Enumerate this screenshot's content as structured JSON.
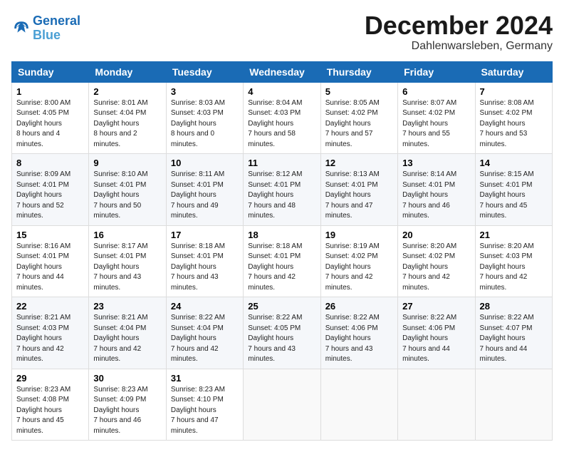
{
  "header": {
    "logo_line1": "General",
    "logo_line2": "Blue",
    "month": "December 2024",
    "location": "Dahlenwarsleben, Germany"
  },
  "weekdays": [
    "Sunday",
    "Monday",
    "Tuesday",
    "Wednesday",
    "Thursday",
    "Friday",
    "Saturday"
  ],
  "weeks": [
    [
      {
        "day": "1",
        "sunrise": "8:00 AM",
        "sunset": "4:05 PM",
        "daylight": "8 hours and 4 minutes."
      },
      {
        "day": "2",
        "sunrise": "8:01 AM",
        "sunset": "4:04 PM",
        "daylight": "8 hours and 2 minutes."
      },
      {
        "day": "3",
        "sunrise": "8:03 AM",
        "sunset": "4:03 PM",
        "daylight": "8 hours and 0 minutes."
      },
      {
        "day": "4",
        "sunrise": "8:04 AM",
        "sunset": "4:03 PM",
        "daylight": "7 hours and 58 minutes."
      },
      {
        "day": "5",
        "sunrise": "8:05 AM",
        "sunset": "4:02 PM",
        "daylight": "7 hours and 57 minutes."
      },
      {
        "day": "6",
        "sunrise": "8:07 AM",
        "sunset": "4:02 PM",
        "daylight": "7 hours and 55 minutes."
      },
      {
        "day": "7",
        "sunrise": "8:08 AM",
        "sunset": "4:02 PM",
        "daylight": "7 hours and 53 minutes."
      }
    ],
    [
      {
        "day": "8",
        "sunrise": "8:09 AM",
        "sunset": "4:01 PM",
        "daylight": "7 hours and 52 minutes."
      },
      {
        "day": "9",
        "sunrise": "8:10 AM",
        "sunset": "4:01 PM",
        "daylight": "7 hours and 50 minutes."
      },
      {
        "day": "10",
        "sunrise": "8:11 AM",
        "sunset": "4:01 PM",
        "daylight": "7 hours and 49 minutes."
      },
      {
        "day": "11",
        "sunrise": "8:12 AM",
        "sunset": "4:01 PM",
        "daylight": "7 hours and 48 minutes."
      },
      {
        "day": "12",
        "sunrise": "8:13 AM",
        "sunset": "4:01 PM",
        "daylight": "7 hours and 47 minutes."
      },
      {
        "day": "13",
        "sunrise": "8:14 AM",
        "sunset": "4:01 PM",
        "daylight": "7 hours and 46 minutes."
      },
      {
        "day": "14",
        "sunrise": "8:15 AM",
        "sunset": "4:01 PM",
        "daylight": "7 hours and 45 minutes."
      }
    ],
    [
      {
        "day": "15",
        "sunrise": "8:16 AM",
        "sunset": "4:01 PM",
        "daylight": "7 hours and 44 minutes."
      },
      {
        "day": "16",
        "sunrise": "8:17 AM",
        "sunset": "4:01 PM",
        "daylight": "7 hours and 43 minutes."
      },
      {
        "day": "17",
        "sunrise": "8:18 AM",
        "sunset": "4:01 PM",
        "daylight": "7 hours and 43 minutes."
      },
      {
        "day": "18",
        "sunrise": "8:18 AM",
        "sunset": "4:01 PM",
        "daylight": "7 hours and 42 minutes."
      },
      {
        "day": "19",
        "sunrise": "8:19 AM",
        "sunset": "4:02 PM",
        "daylight": "7 hours and 42 minutes."
      },
      {
        "day": "20",
        "sunrise": "8:20 AM",
        "sunset": "4:02 PM",
        "daylight": "7 hours and 42 minutes."
      },
      {
        "day": "21",
        "sunrise": "8:20 AM",
        "sunset": "4:03 PM",
        "daylight": "7 hours and 42 minutes."
      }
    ],
    [
      {
        "day": "22",
        "sunrise": "8:21 AM",
        "sunset": "4:03 PM",
        "daylight": "7 hours and 42 minutes."
      },
      {
        "day": "23",
        "sunrise": "8:21 AM",
        "sunset": "4:04 PM",
        "daylight": "7 hours and 42 minutes."
      },
      {
        "day": "24",
        "sunrise": "8:22 AM",
        "sunset": "4:04 PM",
        "daylight": "7 hours and 42 minutes."
      },
      {
        "day": "25",
        "sunrise": "8:22 AM",
        "sunset": "4:05 PM",
        "daylight": "7 hours and 43 minutes."
      },
      {
        "day": "26",
        "sunrise": "8:22 AM",
        "sunset": "4:06 PM",
        "daylight": "7 hours and 43 minutes."
      },
      {
        "day": "27",
        "sunrise": "8:22 AM",
        "sunset": "4:06 PM",
        "daylight": "7 hours and 44 minutes."
      },
      {
        "day": "28",
        "sunrise": "8:22 AM",
        "sunset": "4:07 PM",
        "daylight": "7 hours and 44 minutes."
      }
    ],
    [
      {
        "day": "29",
        "sunrise": "8:23 AM",
        "sunset": "4:08 PM",
        "daylight": "7 hours and 45 minutes."
      },
      {
        "day": "30",
        "sunrise": "8:23 AM",
        "sunset": "4:09 PM",
        "daylight": "7 hours and 46 minutes."
      },
      {
        "day": "31",
        "sunrise": "8:23 AM",
        "sunset": "4:10 PM",
        "daylight": "7 hours and 47 minutes."
      },
      null,
      null,
      null,
      null
    ]
  ],
  "labels": {
    "sunrise": "Sunrise:",
    "sunset": "Sunset:",
    "daylight": "Daylight hours"
  }
}
